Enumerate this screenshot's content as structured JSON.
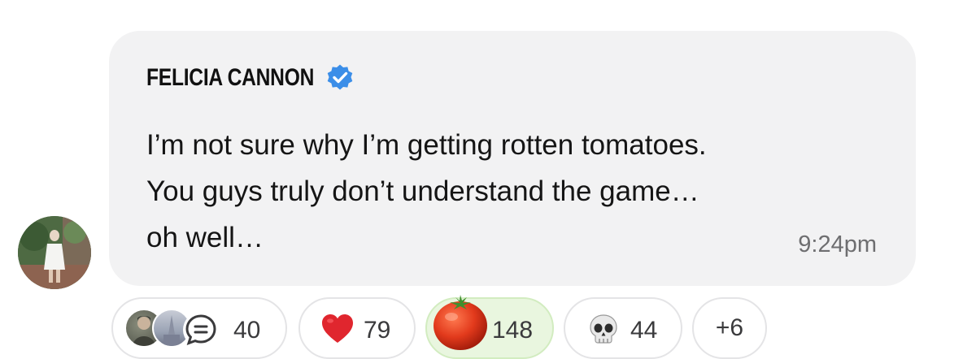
{
  "message": {
    "sender_name": "FELICIA CANNON",
    "verified": true,
    "lines": [
      "I’m not sure why I’m getting rotten tomatoes.",
      "You guys truly don’t understand the game…",
      "oh well…"
    ],
    "timestamp": "9:24pm"
  },
  "reactions": {
    "replies": {
      "count": "40",
      "icon": "reply-bubble-icon"
    },
    "heart": {
      "count": "79",
      "icon": "heart-icon"
    },
    "tomato": {
      "count": "148",
      "icon": "tomato-icon",
      "selected": true
    },
    "skull": {
      "count": "44",
      "icon": "skull-icon"
    },
    "more": {
      "label": "+6"
    }
  },
  "colors": {
    "bubble_bg": "#f2f2f3",
    "verified_blue": "#3b8ee8",
    "timestamp_gray": "#6e6e70",
    "selected_chip_bg": "#e9f6df",
    "chip_border": "#e4e4e6"
  }
}
